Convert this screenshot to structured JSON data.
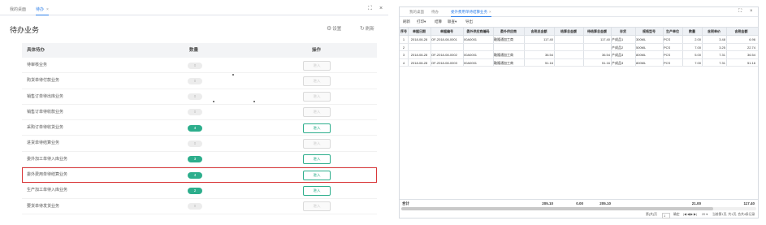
{
  "left": {
    "tabs": [
      {
        "label": "我的桌面",
        "active": false
      },
      {
        "label": "待办",
        "active": true
      }
    ],
    "close_glyph": "×",
    "window_controls": {
      "maximize": "⛶",
      "close": "×"
    },
    "title": "待办业务",
    "actions": {
      "settings": {
        "icon": "⚙",
        "label": "设置"
      },
      "refresh": {
        "icon": "↻",
        "label": "刷新"
      }
    },
    "columns": {
      "name": "具体待办",
      "count": "数量",
      "action": "操作"
    },
    "rows": [
      {
        "name": "待审核业务",
        "count": "0",
        "action": "进入",
        "active": false,
        "highlighted": false
      },
      {
        "name": "购货单待付款业务",
        "count": "0",
        "action": "进入",
        "active": false,
        "highlighted": false
      },
      {
        "name": "销售订单待出库业务",
        "count": "0",
        "action": "进入",
        "active": false,
        "highlighted": false
      },
      {
        "name": "销售订单待收款业务",
        "count": "0",
        "action": "进入",
        "active": false,
        "highlighted": false
      },
      {
        "name": "采购订单待收货业务",
        "count": "4",
        "action": "进入",
        "active": true,
        "highlighted": false
      },
      {
        "name": "进货单待结算业务",
        "count": "0",
        "action": "进入",
        "active": false,
        "highlighted": false
      },
      {
        "name": "委外加工单待入库业务",
        "count": "3",
        "action": "进入",
        "active": true,
        "highlighted": false
      },
      {
        "name": "委外费用单待结算业务",
        "count": "4",
        "action": "进入",
        "active": true,
        "highlighted": true
      },
      {
        "name": "生产加工单待入库业务",
        "count": "2",
        "action": "进入",
        "active": true,
        "highlighted": false
      },
      {
        "name": "要货单待发货业务",
        "count": "0",
        "action": "进入",
        "active": false,
        "highlighted": false
      }
    ]
  },
  "right": {
    "tabs": [
      {
        "label": "我的桌面",
        "active": false
      },
      {
        "label": "待办",
        "active": false
      },
      {
        "label": "委外费用单待结算业务",
        "active": true
      }
    ],
    "close_glyph": "×",
    "window_controls": {
      "maximize": "⛶",
      "close": "×"
    },
    "toolbar": [
      "刷新",
      "打印▾",
      "结算",
      "联查▾",
      "导出"
    ],
    "columns": [
      "序号",
      "单据日期",
      "单据编号",
      "委外供应商编码",
      "委外供应商",
      "含税总金额",
      "结算总金额",
      "待结算总金额",
      "存货",
      "规格型号",
      "生产单位",
      "数量",
      "含税单价",
      "含税金额"
    ],
    "rows": [
      [
        "1",
        "2018-08-28",
        "OF-2018-08-0001",
        "00A0001",
        "鞍隆通加工商",
        "117.40",
        "",
        "117.40",
        "产成品1",
        "300ML",
        "PCS",
        "2.00",
        "3.48",
        "6.96"
      ],
      [
        "2",
        "",
        "",
        "",
        "",
        "",
        "",
        "",
        "产成品2",
        "500ML",
        "PCS",
        "7.00",
        "3.25",
        "22.74"
      ],
      [
        "3",
        "2018-08-28",
        "OF-2018-08-0002",
        "00A0001",
        "鞍隆通加工商",
        "36.54",
        "",
        "36.54",
        "产成品3",
        "800ML",
        "PCS",
        "5.00",
        "7.31",
        "36.54"
      ],
      [
        "4",
        "2018-08-28",
        "OF-2018-08-0003",
        "00A0001",
        "鞍隆通加工商",
        "51.16",
        "",
        "51.16",
        "产成品3",
        "800ML",
        "PCS",
        "7.00",
        "7.31",
        "51.16"
      ]
    ],
    "totals": {
      "label": "合计",
      "tax_total": "205.10",
      "settled": "0.00",
      "unsettled": "205.10",
      "qty": "21.00",
      "amount": "117.40"
    },
    "pager": {
      "prefix": "第(共)页",
      "page": "1",
      "go": "确定",
      "nav": "|◀ ◀ ▶ ▶|",
      "page_size": "20 ▾",
      "summary": "当前第1页, 共1页, 合共4条记录"
    }
  }
}
